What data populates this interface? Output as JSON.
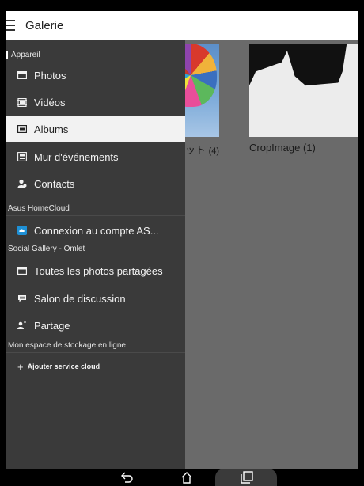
{
  "app": {
    "title": "Galerie"
  },
  "drawer": {
    "sections": [
      {
        "header": "Appareil",
        "items": [
          {
            "label": "Photos",
            "icon": "photos-icon"
          },
          {
            "label": "Vidéos",
            "icon": "videos-icon"
          },
          {
            "label": "Albums",
            "icon": "albums-icon",
            "selected": true
          },
          {
            "label": "Mur d'événements",
            "icon": "event-wall-icon"
          },
          {
            "label": "Contacts",
            "icon": "contacts-icon"
          }
        ]
      },
      {
        "header": "Asus HomeCloud",
        "items": [
          {
            "label": "Connexion au compte AS...",
            "icon": "homecloud-icon"
          }
        ]
      },
      {
        "header": "Social Gallery - Omlet",
        "items": [
          {
            "label": "Toutes les photos partagées",
            "icon": "shared-photos-icon"
          },
          {
            "label": "Salon de discussion",
            "icon": "chat-icon"
          },
          {
            "label": "Partage",
            "icon": "share-icon"
          }
        ]
      },
      {
        "header": "Mon espace de stockage en ligne",
        "add_label": "Ajouter service cloud"
      }
    ]
  },
  "albums": [
    {
      "name": "ット",
      "count": "(4)"
    },
    {
      "name": "CropImage",
      "count": "(1)"
    }
  ],
  "colors": {
    "drawer_bg": "#3a3a3a",
    "selected_bg": "#f2f2f2",
    "content_bg": "#6a6a6a",
    "appbar_bg": "#ffffff",
    "homecloud_accent": "#1e90d6"
  },
  "navbar": {
    "buttons": [
      "back-icon",
      "home-icon",
      "recents-icon"
    ]
  }
}
